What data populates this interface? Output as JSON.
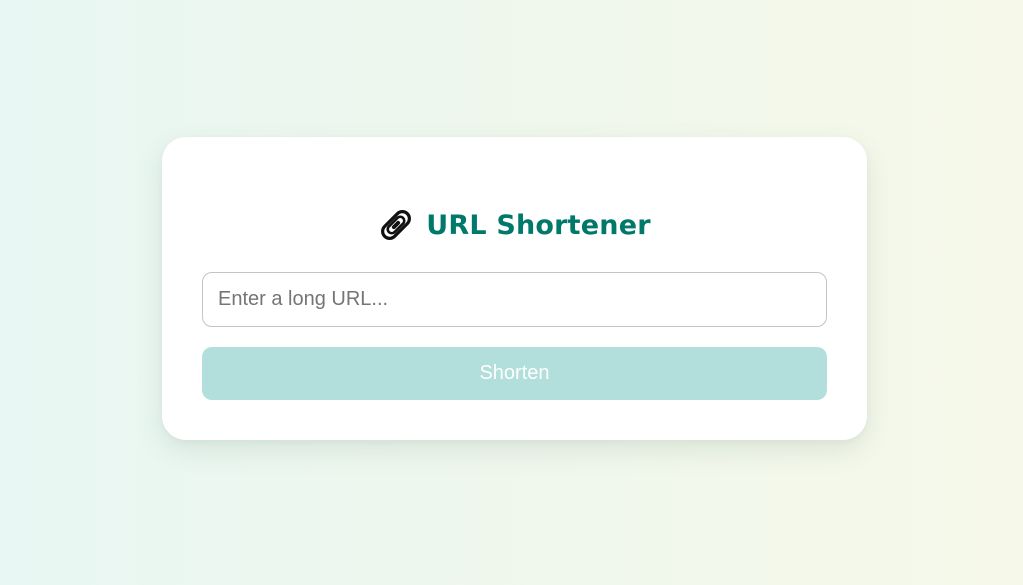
{
  "app": {
    "title": "URL Shortener",
    "icon": "link-icon"
  },
  "form": {
    "url_input_value": "",
    "url_input_placeholder": "Enter a long URL...",
    "submit_label": "Shorten",
    "submit_disabled": true
  },
  "colors": {
    "accent": "#00796b",
    "button_disabled_bg": "#b2dfdb",
    "card_bg": "#ffffff"
  }
}
